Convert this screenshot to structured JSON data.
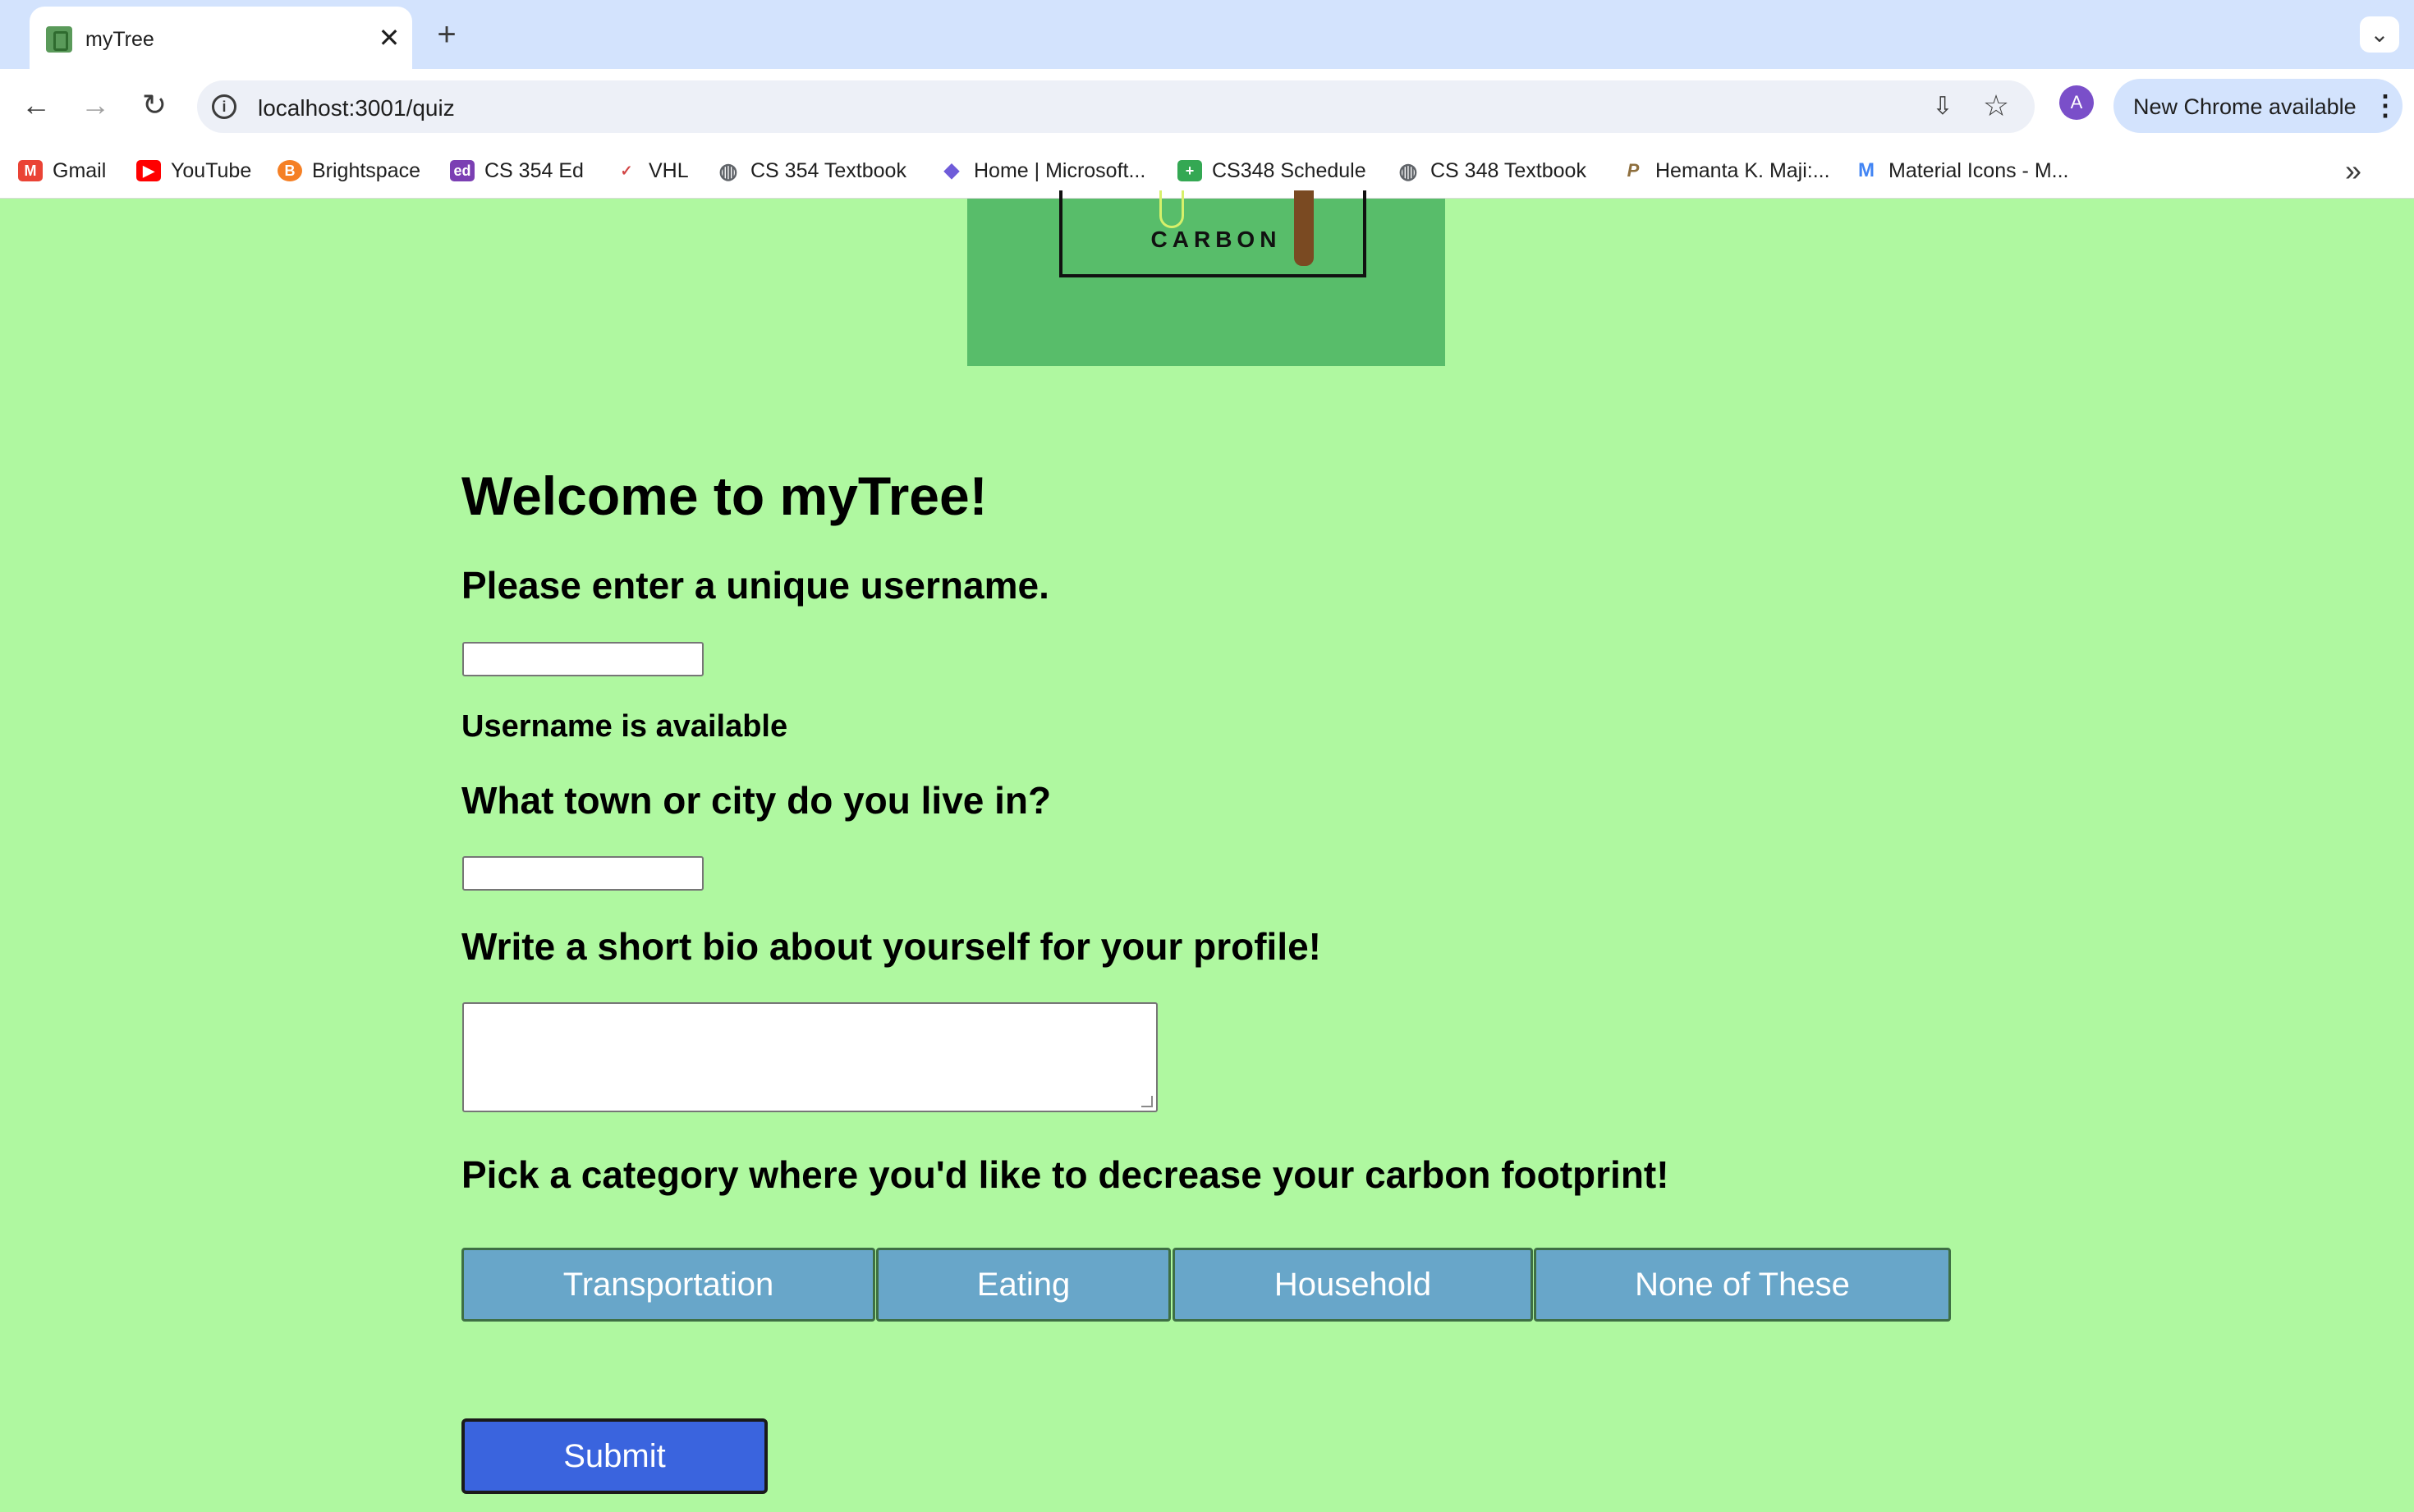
{
  "browser": {
    "tab_title": "myTree",
    "tab_close": "✕",
    "new_tab": "+",
    "tab_search": "⌄",
    "url": "localhost:3001/quiz",
    "nav": {
      "back": "←",
      "forward": "→",
      "reload": "↻"
    },
    "info_icon": "i",
    "install_icon": "⇩",
    "star_icon": "☆",
    "avatar_letter": "A",
    "update_label": "New Chrome available",
    "update_menu": "⋮",
    "bookmarks_more": "»",
    "bookmarks": [
      {
        "label": "Gmail",
        "icon": "gmail-icon",
        "glyph": "M",
        "color": "#ea4335"
      },
      {
        "label": "YouTube",
        "icon": "youtube-icon",
        "glyph": "▶",
        "color": "#ff0000"
      },
      {
        "label": "Brightspace",
        "icon": "brightspace-icon",
        "glyph": "B",
        "color": "#f58025"
      },
      {
        "label": "CS 354 Ed",
        "icon": "ed-icon",
        "glyph": "ed",
        "color": "#7b3fb3"
      },
      {
        "label": "VHL",
        "icon": "vhl-icon",
        "glyph": "✓",
        "color": "#d24545"
      },
      {
        "label": "CS 354 Textbook",
        "icon": "globe-icon",
        "glyph": "◍",
        "color": "#5f6368"
      },
      {
        "label": "Home | Microsoft...",
        "icon": "microsoft-icon",
        "glyph": "◆",
        "color": "#6f5cd9"
      },
      {
        "label": "CS348 Schedule",
        "icon": "sheets-icon",
        "glyph": "+",
        "color": "#34a853"
      },
      {
        "label": "CS 348 Textbook",
        "icon": "globe-icon",
        "glyph": "◍",
        "color": "#5f6368"
      },
      {
        "label": "Hemanta K. Maji:...",
        "icon": "purdue-icon",
        "glyph": "P",
        "color": "#8e6f3e"
      },
      {
        "label": "Material Icons - M...",
        "icon": "material-icon",
        "glyph": "M",
        "color": "#4285f4"
      }
    ]
  },
  "page": {
    "logo_text": "CARBON",
    "heading": "Welcome to myTree!",
    "username_prompt": "Please enter a unique username.",
    "username_value": "",
    "username_status": "Username is available",
    "city_prompt": "What town or city do you live in?",
    "city_value": "",
    "bio_prompt": "Write a short bio about yourself for your profile!",
    "bio_value": "",
    "category_prompt": "Pick a category where you'd like to decrease your carbon footprint!",
    "categories": [
      "Transportation",
      "Eating",
      "Household",
      "None of These"
    ],
    "submit_label": "Submit"
  },
  "colors": {
    "page_bg": "#aff8a0",
    "logo_bg": "#58bd6a",
    "category_button": "#68a6c9",
    "submit_button": "#3a64de"
  }
}
